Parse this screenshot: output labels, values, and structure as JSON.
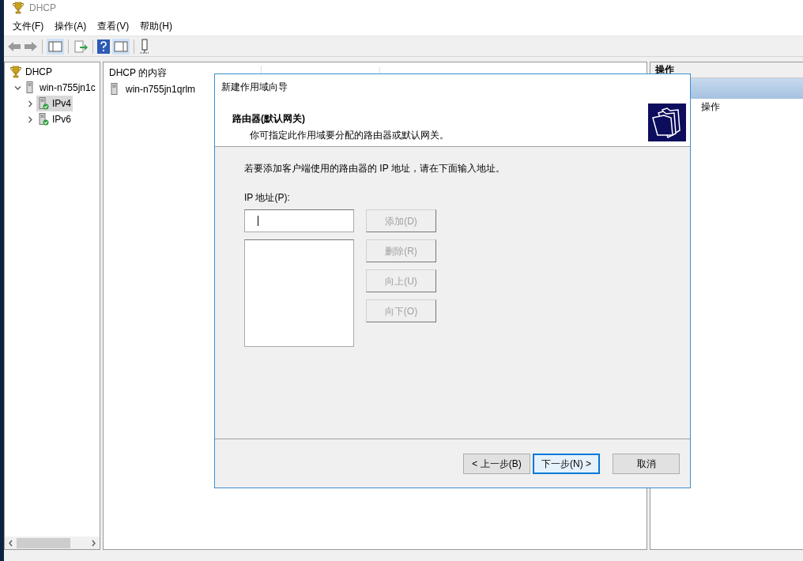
{
  "window": {
    "title": "DHCP"
  },
  "menu": [
    "文件(F)",
    "操作(A)",
    "查看(V)",
    "帮助(H)"
  ],
  "tree": [
    {
      "label": "DHCP",
      "kind": "root",
      "children": [
        {
          "label": "win-n755jn1c",
          "kind": "server",
          "expanded": true,
          "selected": false,
          "children": [
            {
              "label": "IPv4",
              "kind": "scope",
              "expanded": false,
              "selected": true
            },
            {
              "label": "IPv6",
              "kind": "scope",
              "expanded": false,
              "selected": false
            }
          ]
        }
      ]
    }
  ],
  "content": {
    "title": "DHCP 的内容",
    "rows": [
      "win-n755jn1qrlm"
    ]
  },
  "actions": {
    "title": "操作",
    "items": [
      "操作"
    ]
  },
  "dialog": {
    "title": "新建作用域向导",
    "heading": "路由器(默认网关)",
    "subtitle": "你可指定此作用域要分配的路由器或默认网关。",
    "instruction": "若要添加客户端使用的路由器的 IP 地址，请在下面输入地址。",
    "field_label": "IP 地址(P):",
    "side_buttons": [
      {
        "label": "添加(D)",
        "disabled": true
      },
      {
        "label": "删除(R)",
        "disabled": true
      },
      {
        "label": "向上(U)",
        "disabled": true
      },
      {
        "label": "向下(O)",
        "disabled": true
      }
    ],
    "buttons": [
      {
        "label": "< 上一步(B)",
        "default": false
      },
      {
        "label": "下一步(N) >",
        "default": true
      },
      {
        "label": "取消",
        "default": false
      }
    ]
  }
}
